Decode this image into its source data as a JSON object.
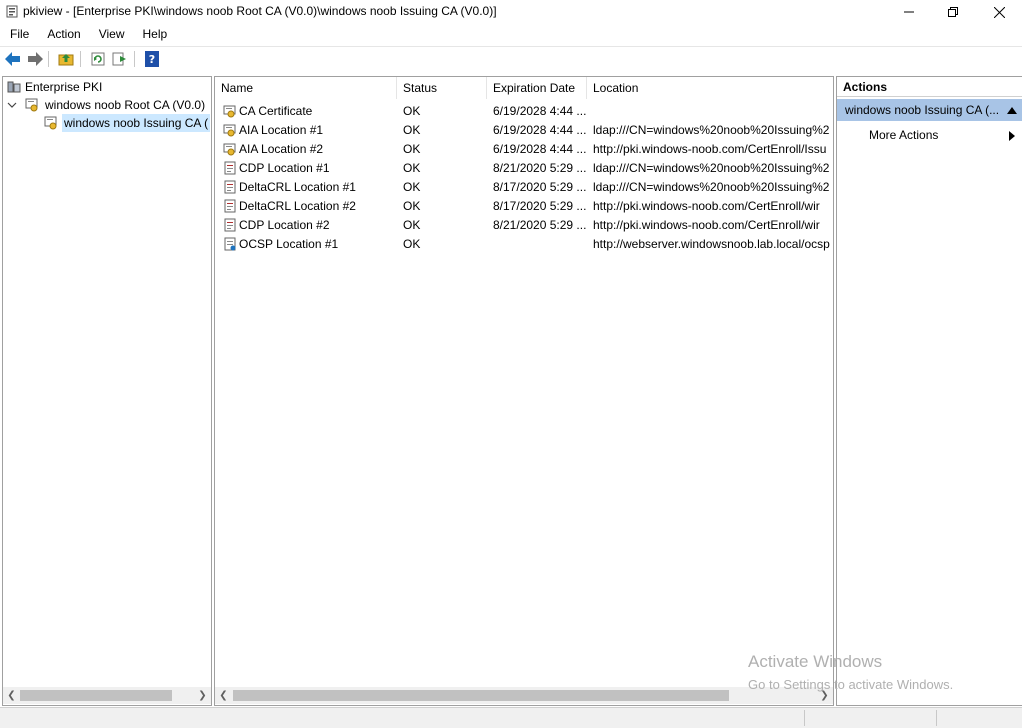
{
  "window": {
    "title": "pkiview - [Enterprise PKI\\windows noob Root CA (V0.0)\\windows noob Issuing CA (V0.0)]"
  },
  "menu": {
    "items": [
      "File",
      "Action",
      "View",
      "Help"
    ]
  },
  "toolbar": {
    "buttons": [
      "back-arrow-icon",
      "forward-arrow-icon",
      "up-folder-icon",
      "refresh-icon",
      "export-list-icon",
      "help-icon"
    ]
  },
  "tree": {
    "root": "Enterprise PKI",
    "child": "windows noob Root CA (V0.0)",
    "grandchild": "windows noob Issuing CA ("
  },
  "list": {
    "columns": [
      "Name",
      "Status",
      "Expiration Date",
      "Location"
    ],
    "rows": [
      {
        "name": "CA Certificate",
        "status": "OK",
        "expiration": "6/19/2028 4:44 ...",
        "location": "",
        "icon": "certificate-icon"
      },
      {
        "name": "AIA Location #1",
        "status": "OK",
        "expiration": "6/19/2028 4:44 ...",
        "location": "ldap:///CN=windows%20noob%20Issuing%2",
        "icon": "certificate-icon"
      },
      {
        "name": "AIA Location #2",
        "status": "OK",
        "expiration": "6/19/2028 4:44 ...",
        "location": "http://pki.windows-noob.com/CertEnroll/Issu",
        "icon": "certificate-icon"
      },
      {
        "name": "CDP Location #1",
        "status": "OK",
        "expiration": "8/21/2020 5:29 ...",
        "location": "ldap:///CN=windows%20noob%20Issuing%2",
        "icon": "crl-icon"
      },
      {
        "name": "DeltaCRL Location #1",
        "status": "OK",
        "expiration": "8/17/2020 5:29 ...",
        "location": "ldap:///CN=windows%20noob%20Issuing%2",
        "icon": "crl-icon"
      },
      {
        "name": "DeltaCRL Location #2",
        "status": "OK",
        "expiration": "8/17/2020 5:29 ...",
        "location": "http://pki.windows-noob.com/CertEnroll/wir",
        "icon": "crl-icon"
      },
      {
        "name": "CDP Location #2",
        "status": "OK",
        "expiration": "8/21/2020 5:29 ...",
        "location": "http://pki.windows-noob.com/CertEnroll/wir",
        "icon": "crl-icon"
      },
      {
        "name": "OCSP Location #1",
        "status": "OK",
        "expiration": "",
        "location": "http://webserver.windowsnoob.lab.local/ocsp",
        "icon": "ocsp-icon"
      }
    ]
  },
  "actions": {
    "title": "Actions",
    "selected": "windows noob Issuing CA (...",
    "more": "More Actions"
  },
  "watermark": {
    "line1": "Activate Windows",
    "line2": "Go to Settings to activate Windows."
  },
  "colors": {
    "selection": "#cce8ff",
    "actions_header": "#a8c4e6",
    "icon_blue": "#1e73be",
    "icon_yellow": "#e8b830"
  }
}
